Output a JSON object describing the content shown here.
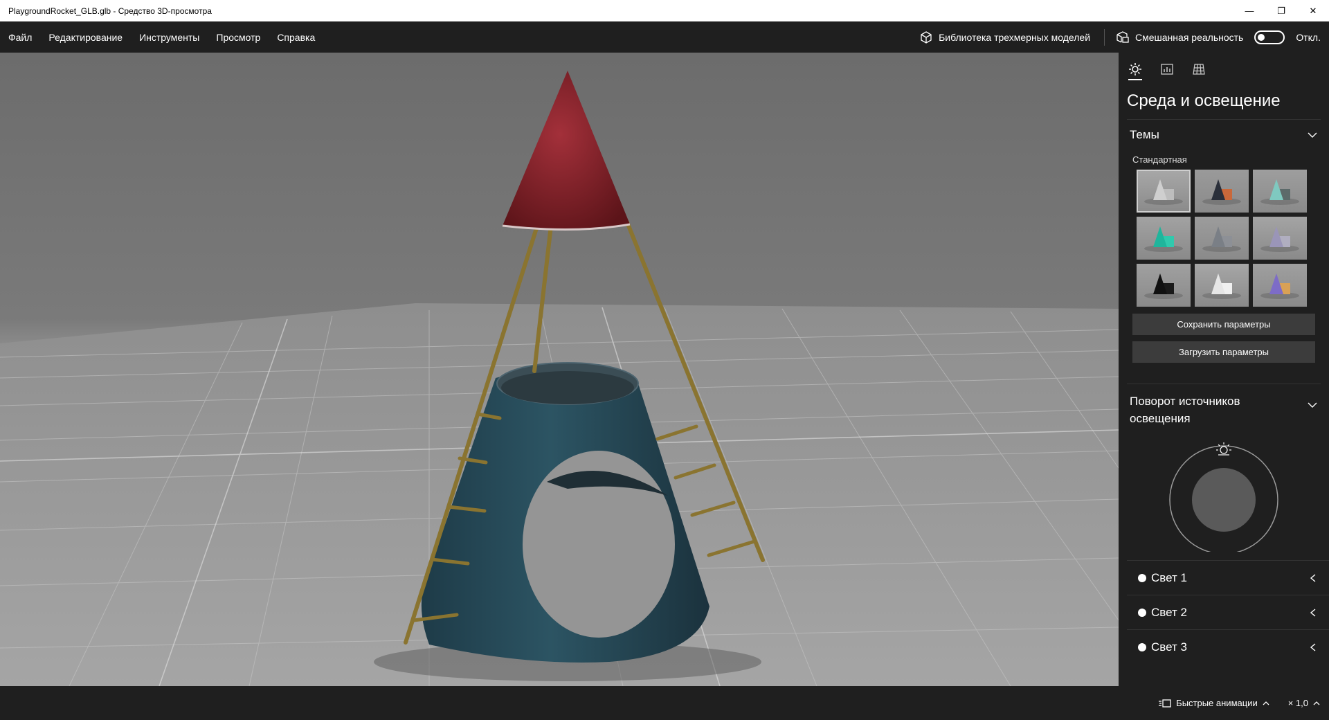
{
  "window": {
    "title": "PlaygroundRocket_GLB.glb - Средство 3D-просмотра",
    "minimize_glyph": "—",
    "restore_glyph": "❐",
    "close_glyph": "✕"
  },
  "menu": {
    "items": [
      "Файл",
      "Редактирование",
      "Инструменты",
      "Просмотр",
      "Справка"
    ],
    "library_label": "Библиотека трехмерных моделей",
    "mixed_reality_label": "Смешанная реальность",
    "mixed_reality_state": "Откл."
  },
  "panel": {
    "tabs": [
      {
        "icon": "sun-icon",
        "active": true
      },
      {
        "icon": "stats-icon",
        "active": false
      },
      {
        "icon": "grid-icon",
        "active": false
      }
    ],
    "title": "Среда и освещение",
    "themes": {
      "heading": "Темы",
      "group_label": "Стандартная",
      "thumbnails": [
        {
          "bg": "#a8a8a8",
          "c1": "#cfcfcf",
          "c2": "#bdbdbd",
          "selected": true
        },
        {
          "bg": "#9a9a9a",
          "c1": "#2a2f3a",
          "c2": "#c9683a",
          "selected": false
        },
        {
          "bg": "#9e9e9e",
          "c1": "#7fc9c0",
          "c2": "#5c6a6a",
          "selected": false
        },
        {
          "bg": "#a2a2a2",
          "c1": "#1fb59c",
          "c2": "#30c9ad",
          "selected": false
        },
        {
          "bg": "#9c9c9c",
          "c1": "#7a7f86",
          "c2": "#8d9096",
          "selected": false
        },
        {
          "bg": "#a4a4a4",
          "c1": "#9a95b8",
          "c2": "#b0aec0",
          "selected": false
        },
        {
          "bg": "#a0a0a0",
          "c1": "#111111",
          "c2": "#1a1a1a",
          "selected": false
        },
        {
          "bg": "#a6a6a6",
          "c1": "#e6e6e6",
          "c2": "#f0f0f0",
          "selected": false
        },
        {
          "bg": "#9f9f9f",
          "c1": "#7d6cc7",
          "c2": "#d9a155",
          "selected": false
        }
      ],
      "save_label": "Сохранить параметры",
      "load_label": "Загрузить параметры"
    },
    "rotation": {
      "heading": "Поворот источников освещения"
    },
    "lights": [
      {
        "label": "Свет 1"
      },
      {
        "label": "Свет 2"
      },
      {
        "label": "Свет 3"
      }
    ]
  },
  "bottom": {
    "animations_label": "Быстрые анимации",
    "speed_label": "× 1,0"
  }
}
